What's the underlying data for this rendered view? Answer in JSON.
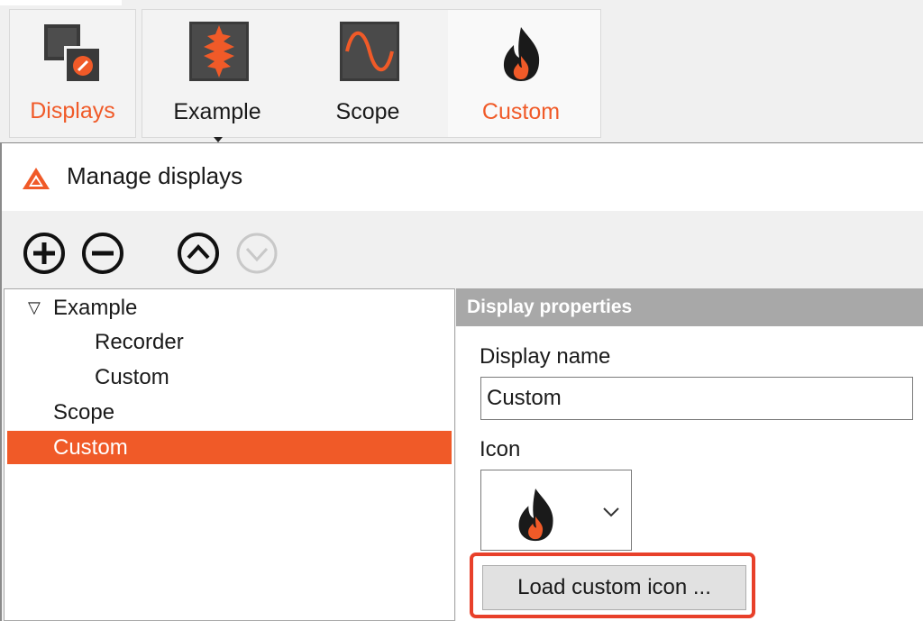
{
  "ribbon": {
    "displays_label": "Displays",
    "example_label": "Example",
    "scope_label": "Scope",
    "custom_label": "Custom",
    "accent_color": "#f05a28"
  },
  "dialog": {
    "title": "Manage displays",
    "toolbar": {
      "add_icon": "plus-circle-icon",
      "remove_icon": "minus-circle-icon",
      "move_up_icon": "chevron-up-circle-icon",
      "move_down_icon": "chevron-down-circle-icon"
    },
    "tree": {
      "expander": "▽",
      "items": [
        {
          "label": "Example"
        },
        {
          "label": "Recorder"
        },
        {
          "label": "Custom"
        },
        {
          "label": "Scope"
        },
        {
          "label": "Custom",
          "selected": true
        }
      ]
    },
    "properties": {
      "header": "Display properties",
      "display_name_label": "Display name",
      "display_name_value": "Custom",
      "icon_label": "Icon",
      "icon_value": "flame-icon",
      "load_button": "Load custom icon ..."
    }
  }
}
